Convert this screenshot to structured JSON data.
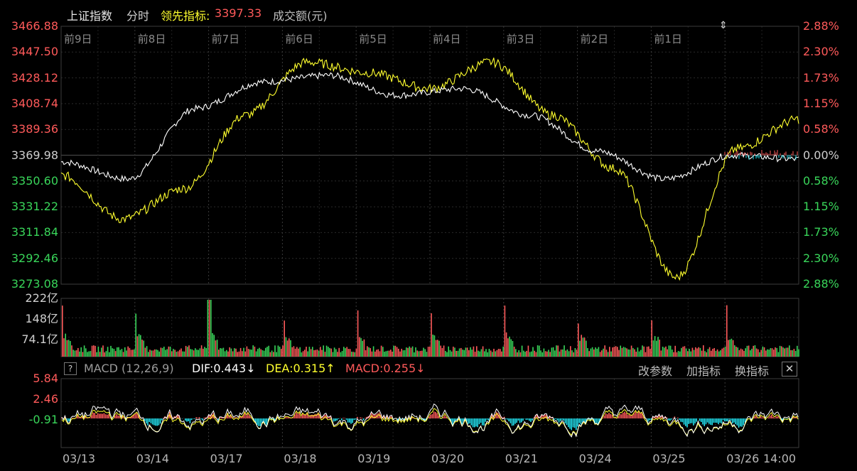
{
  "header": {
    "index_name": "上证指数",
    "mode": "分时",
    "lead_label": "领先指标:",
    "lead_value": "3397.33",
    "volume_label": "成交额(元)"
  },
  "colors": {
    "up": "#ff5a5a",
    "down": "#39d65a",
    "index_line": "#ffffff",
    "lead_line": "#ffff2e",
    "macd_neg": "#22e0ee",
    "grid": "#2a2a2a"
  },
  "price_axis": {
    "left": [
      "3466.88",
      "3447.50",
      "3428.12",
      "3408.74",
      "3389.36",
      "3369.98",
      "3350.60",
      "3331.22",
      "3311.84",
      "3292.46",
      "3273.08"
    ],
    "right": [
      "2.88%",
      "2.30%",
      "1.73%",
      "1.15%",
      "0.58%",
      "0.00%",
      "0.58%",
      "1.15%",
      "1.73%",
      "2.30%",
      "2.88%"
    ]
  },
  "day_labels": [
    "前9日",
    "前8日",
    "前7日",
    "前6日",
    "前5日",
    "前4日",
    "前3日",
    "前2日",
    "前1日"
  ],
  "volume_axis": [
    "222亿",
    "148亿",
    "74.1亿"
  ],
  "macd": {
    "help_label": "?",
    "name": "MACD (12,26,9)",
    "dif": "DIF:0.443↓",
    "dea": "DEA:0.315↑",
    "macd": "MACD:0.255↓",
    "btn_params": "改参数",
    "btn_add": "加指标",
    "btn_switch": "换指标",
    "close_label": "✕",
    "axis": [
      "5.84",
      "2.46",
      "-0.91"
    ]
  },
  "dates": [
    "03/13",
    "03/14",
    "03/17",
    "03/18",
    "03/19",
    "03/20",
    "03/21",
    "03/24",
    "03/25",
    "03/26",
    "14:00"
  ],
  "chart_data": {
    "type": "line",
    "title": "",
    "ylim": [
      3273.08,
      3466.88
    ],
    "categories": [
      "03/13",
      "03/14",
      "03/17",
      "03/18",
      "03/19",
      "03/20",
      "03/21",
      "03/24",
      "03/25",
      "03/26"
    ],
    "series": [
      {
        "name": "上证指数",
        "values": [
          3365,
          3352,
          3405,
          3425,
          3430,
          3415,
          3420,
          3400,
          3373,
          3352,
          3370,
          3367
        ]
      },
      {
        "name": "领先指标",
        "values": [
          3355,
          3322,
          3345,
          3400,
          3440,
          3432,
          3420,
          3440,
          3400,
          3360,
          3278,
          3375,
          3397
        ]
      }
    ],
    "volume_axis_ticks": [
      "222亿",
      "148亿",
      "74.1亿"
    ],
    "macd_ylim": [
      -0.91,
      5.84
    ]
  }
}
